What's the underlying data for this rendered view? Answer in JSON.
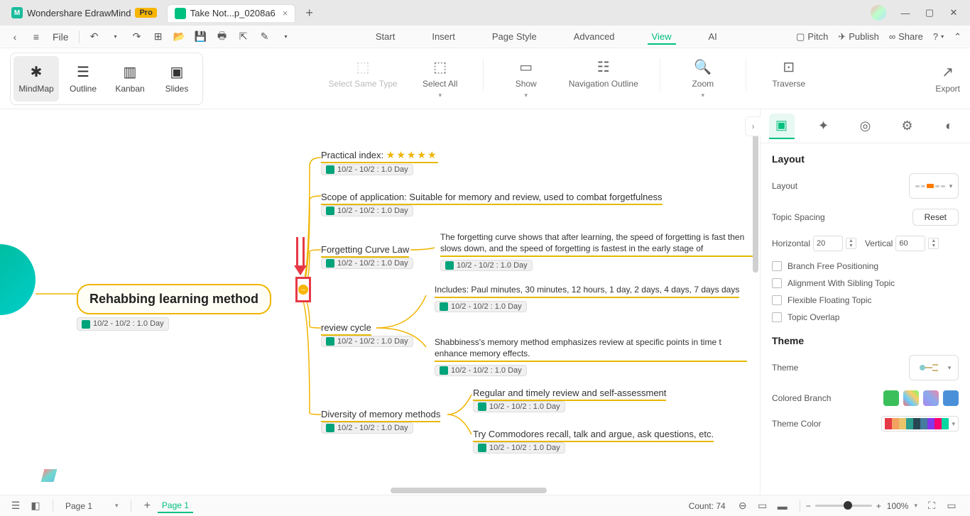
{
  "titlebar": {
    "app_name": "Wondershare EdrawMind",
    "pro_badge": "Pro",
    "doc_tab": "Take Not...p_0208a6",
    "close": "×",
    "add": "+"
  },
  "menubar": {
    "file": "File",
    "items": [
      "Start",
      "Insert",
      "Page Style",
      "Advanced",
      "View",
      "AI"
    ],
    "active_index": 4,
    "right": {
      "pitch": "Pitch",
      "publish": "Publish",
      "share": "Share"
    }
  },
  "ribbon": {
    "views": {
      "mindmap": "MindMap",
      "outline": "Outline",
      "kanban": "Kanban",
      "slides": "Slides"
    },
    "select_same_type": "Select Same Type",
    "select_all": "Select All",
    "show": "Show",
    "nav_outline": "Navigation Outline",
    "zoom": "Zoom",
    "traverse": "Traverse",
    "export": "Export"
  },
  "mindmap": {
    "root": {
      "text": "Rehabbing learning method",
      "date": "10/2 - 10/2 : 1.0 Day"
    },
    "c1": {
      "text": "Practical index:",
      "date": "10/2 - 10/2 : 1.0 Day"
    },
    "c2": {
      "text": "Scope of application: Suitable for memory and review, used to combat forgetfulness",
      "date": "10/2 - 10/2 : 1.0 Day"
    },
    "c3": {
      "text": "Forgetting Curve Law",
      "date": "10/2 - 10/2 : 1.0 Day",
      "sub": {
        "text": "The forgetting curve shows that after learning, the speed of forgetting is fast then slows down, and the speed of forgetting is fastest in the early stage of",
        "date": "10/2 - 10/2 : 1.0 Day"
      }
    },
    "c4": {
      "text": "review cycle",
      "date": "10/2 - 10/2 : 1.0 Day",
      "sub1": {
        "text": "Includes: Paul minutes, 30 minutes, 12 hours, 1 day, 2 days, 4 days, 7 days days",
        "date": "10/2 - 10/2 : 1.0 Day"
      },
      "sub2": {
        "text": "Shabbiness's memory method emphasizes review at specific points in time t enhance memory effects.",
        "date": "10/2 - 10/2 : 1.0 Day"
      }
    },
    "c5": {
      "text": "Diversity of memory methods",
      "date": "10/2 - 10/2 : 1.0 Day",
      "sub1": {
        "text": "Regular and timely review and self-assessment",
        "date": "10/2 - 10/2 : 1.0 Day"
      },
      "sub2": {
        "text": "Try Commodores recall, talk and argue, ask questions, etc.",
        "date": "10/2 - 10/2 : 1.0 Day"
      }
    }
  },
  "panel": {
    "layout_title": "Layout",
    "layout_label": "Layout",
    "topic_spacing": "Topic Spacing",
    "reset": "Reset",
    "horizontal": "Horizontal",
    "horizontal_val": "20",
    "vertical": "Vertical",
    "vertical_val": "60",
    "opt1": "Branch Free Positioning",
    "opt2": "Alignment With Sibling Topic",
    "opt3": "Flexible Floating Topic",
    "opt4": "Topic Overlap",
    "theme_title": "Theme",
    "theme_label": "Theme",
    "colored_branch": "Colored Branch",
    "theme_color": "Theme Color"
  },
  "statusbar": {
    "page_selector": "Page 1",
    "page_tab": "Page 1",
    "count": "Count: 74",
    "zoom_pct": "100%",
    "add": "+"
  }
}
